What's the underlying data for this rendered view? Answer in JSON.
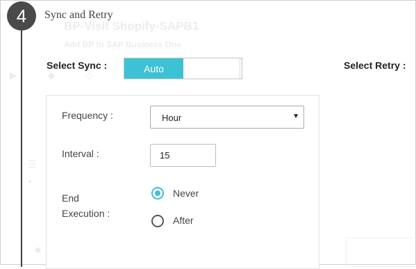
{
  "step": {
    "number": "4",
    "title": "Sync and Retry"
  },
  "background": {
    "title": "BP-Visit Shopify-SAPB1",
    "subtitle": "Add BP to SAP Business One"
  },
  "sync": {
    "label": "Select Sync :",
    "toggle_value": "Auto",
    "toggle_on": true
  },
  "retry": {
    "label": "Select Retry :"
  },
  "frequency": {
    "label": "Frequency :",
    "selected": "Hour",
    "arrow_icon": "triangle-down-icon"
  },
  "interval": {
    "label": "Interval :",
    "value": "15"
  },
  "end_execution": {
    "label_line1": "End",
    "label_line2": "Execution :",
    "options": [
      {
        "label": "Never",
        "checked": true
      },
      {
        "label": "After",
        "checked": false
      }
    ]
  },
  "colors": {
    "accent": "#3ec1d4",
    "step_circle": "#4a4a4a"
  }
}
